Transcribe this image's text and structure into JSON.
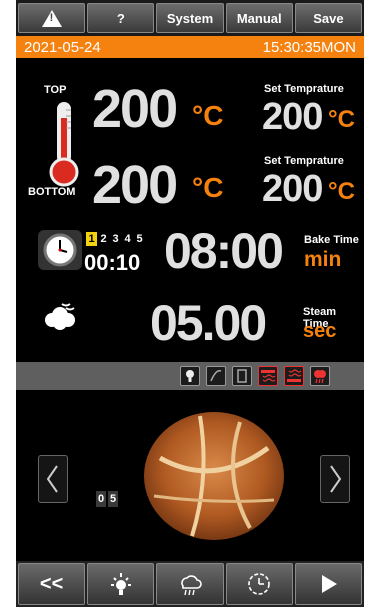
{
  "toolbar": {
    "warning_icon": "warning-icon",
    "help_label": "?",
    "system_label": "System",
    "manual_label": "Manual",
    "save_label": "Save"
  },
  "datebar": {
    "date": "2021-05-24",
    "time": "15:30:35MON"
  },
  "temperature": {
    "top_label": "TOP",
    "bottom_label": "BOTTOM",
    "top_value": "200",
    "bottom_value": "200",
    "unit": "°C",
    "set_title": "Set Temprature",
    "set_top_value": "200",
    "set_bottom_value": "200"
  },
  "bake": {
    "steps": [
      "1",
      "2",
      "3",
      "4",
      "5"
    ],
    "active_step": 1,
    "elapsed": "00:10",
    "value": "08:00",
    "label": "Bake Time",
    "unit": "min"
  },
  "steam": {
    "value": "05.00",
    "label": "Steam Time",
    "unit": "sec"
  },
  "tray": {
    "count": [
      "0",
      "5"
    ]
  },
  "bottombar": {
    "back_label": "<<"
  },
  "colors": {
    "accent": "#f5820f",
    "step_active": "#f5d20f",
    "background": "#000000"
  },
  "icons": [
    "light-icon",
    "fan-icon",
    "door-icon",
    "heater-top-icon",
    "heater-bottom-icon",
    "steam-icon",
    "clock-icon",
    "cloud-icon",
    "timer-icon",
    "play-icon"
  ]
}
